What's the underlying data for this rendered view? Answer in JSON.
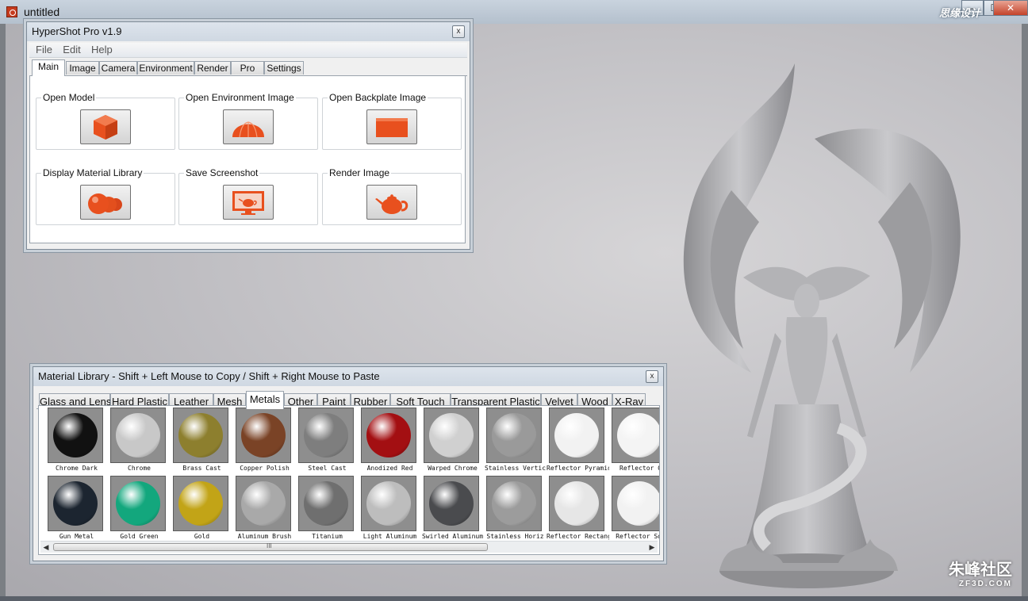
{
  "window": {
    "title": "untitled",
    "buttons": {
      "minimize": "–",
      "maximize": "☐",
      "close": "✕"
    },
    "watermark_top": "思缘设计",
    "watermark_bottom": {
      "main": "朱峰社区",
      "sub": "ZF3D.COM"
    }
  },
  "hypershot": {
    "title": "HyperShot Pro v1.9",
    "close": "x",
    "menu": [
      "File",
      "Edit",
      "Help"
    ],
    "tabs": [
      "Main",
      "Image",
      "Camera",
      "Environment",
      "Render",
      "Pro",
      "Settings"
    ],
    "active_tab": "Main",
    "groups": [
      {
        "label": "Open Model",
        "icon": "cube-icon"
      },
      {
        "label": "Open Environment Image",
        "icon": "dome-icon"
      },
      {
        "label": "Open Backplate Image",
        "icon": "rectangle-icon"
      },
      {
        "label": "Display Material Library",
        "icon": "spheres-icon"
      },
      {
        "label": "Save Screenshot",
        "icon": "monitor-teapot-icon"
      },
      {
        "label": "Render Image",
        "icon": "teapot-icon"
      }
    ],
    "accent_color": "#e8501e"
  },
  "material_library": {
    "title": "Material Library - Shift + Left Mouse to Copy / Shift + Right Mouse to Paste",
    "close": "x",
    "tabs": [
      "Glass and Lens",
      "Hard Plastic",
      "Leather",
      "Mesh",
      "Metals",
      "Other",
      "Paint",
      "Rubber",
      "Soft Touch",
      "Transparent Plastic",
      "Velvet",
      "Wood",
      "X-Ray"
    ],
    "active_tab": "Metals",
    "row1": [
      {
        "name": "Chrome Dark",
        "color": "#111111"
      },
      {
        "name": "Chrome",
        "color": "#c8c8c8"
      },
      {
        "name": "Brass Cast",
        "color": "#8d7f2e"
      },
      {
        "name": "Copper Polish",
        "color": "#7a4326"
      },
      {
        "name": "Steel Cast",
        "color": "#7e7e7e"
      },
      {
        "name": "Anodized Red",
        "color": "#a30f12"
      },
      {
        "name": "Warped Chrome",
        "color": "#d0d0d0"
      },
      {
        "name": "Stainless Vertic",
        "color": "#9a9a9a"
      },
      {
        "name": "Reflector Pyramids",
        "color": "#f2f2f2"
      },
      {
        "name": "Reflector C",
        "color": "#f4f4f4"
      }
    ],
    "row2": [
      {
        "name": "Gun Metal",
        "color": "#1c2530"
      },
      {
        "name": "Gold Green",
        "color": "#13a77d"
      },
      {
        "name": "Gold",
        "color": "#c2a417"
      },
      {
        "name": "Aluminum Brush",
        "color": "#a9a9a9"
      },
      {
        "name": "Titanium",
        "color": "#6f6f6f"
      },
      {
        "name": "Light Aluminum",
        "color": "#bdbdbd"
      },
      {
        "name": "Swirled Aluminum",
        "color": "#4a4b4e"
      },
      {
        "name": "Stainless Horiz",
        "color": "#9c9c9c"
      },
      {
        "name": "Reflector Rectang",
        "color": "#e6e6e6"
      },
      {
        "name": "Reflector Squ",
        "color": "#f2f2f2"
      }
    ],
    "scroll_thumb_label": "III"
  }
}
